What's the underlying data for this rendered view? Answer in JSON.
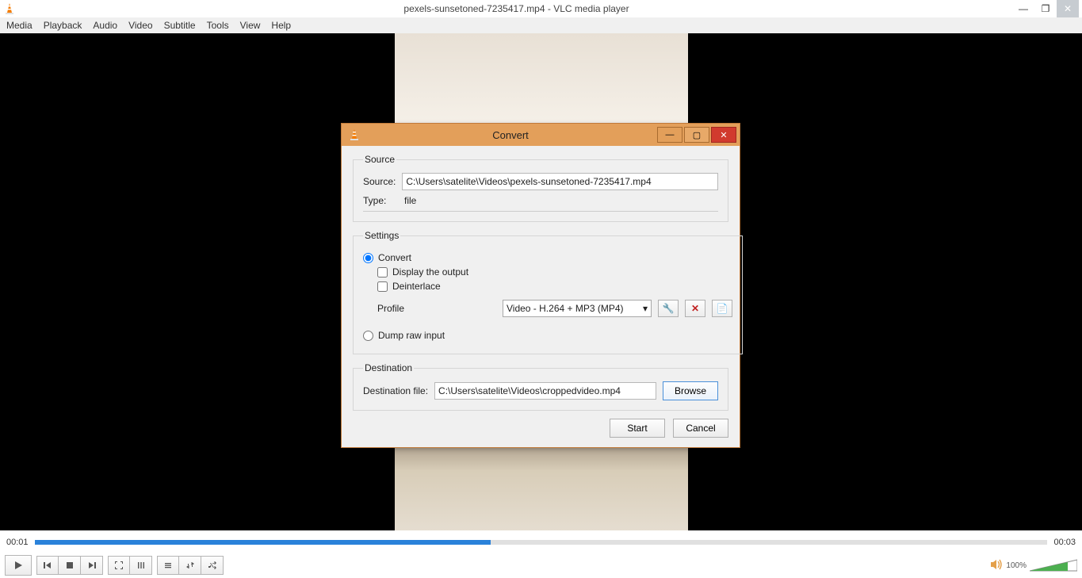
{
  "window": {
    "title": "pexels-sunsetoned-7235417.mp4 - VLC media player"
  },
  "menu": {
    "media": "Media",
    "playback": "Playback",
    "audio": "Audio",
    "video": "Video",
    "subtitle": "Subtitle",
    "tools": "Tools",
    "view": "View",
    "help": "Help"
  },
  "timeline": {
    "current": "00:01",
    "total": "00:03",
    "percent": 45
  },
  "volume": {
    "label": "100%"
  },
  "dialog": {
    "title": "Convert",
    "source_group": "Source",
    "source_label": "Source:",
    "source_value": "C:\\Users\\satelite\\Videos\\pexels-sunsetoned-7235417.mp4",
    "type_label": "Type:",
    "type_value": "file",
    "settings_group": "Settings",
    "convert_label": "Convert",
    "display_output_label": "Display the output",
    "deinterlace_label": "Deinterlace",
    "profile_label": "Profile",
    "profile_value": "Video - H.264 + MP3 (MP4)",
    "dump_label": "Dump raw input",
    "destination_group": "Destination",
    "destination_file_label": "Destination file:",
    "destination_file_value": "C:\\Users\\satelite\\Videos\\croppedvideo.mp4",
    "browse_label": "Browse",
    "start_label": "Start",
    "cancel_label": "Cancel"
  }
}
